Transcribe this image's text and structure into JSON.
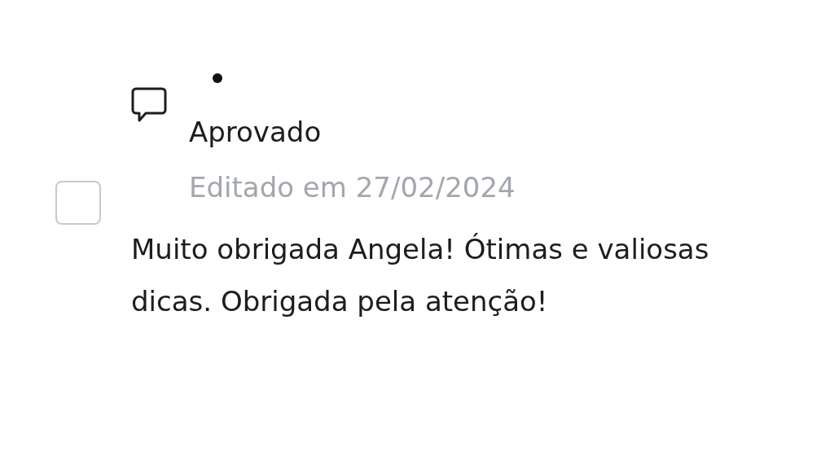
{
  "comment": {
    "checked": false,
    "status": "Aprovado",
    "edited": "Editado em 27/02/2024",
    "text": "Muito obrigada Angela! Ótimas e valiosas dicas. Obrigada pela atenção!"
  }
}
